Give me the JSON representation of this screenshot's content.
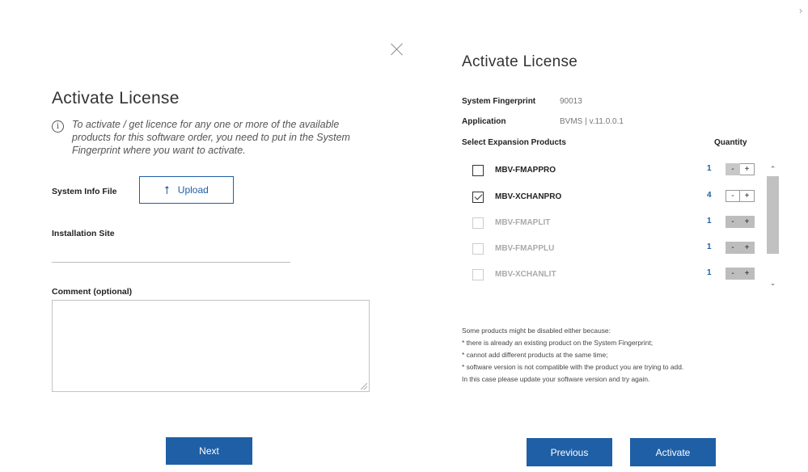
{
  "left": {
    "title": "Activate License",
    "info_text": "To activate / get licence for any one or more of the available products for this software order, you need to put in the System Fingerprint where you want to activate.",
    "system_info_label": "System Info File",
    "upload_label": "Upload",
    "installation_site_label": "Installation Site",
    "installation_site_value": "",
    "comment_label": "Comment (optional)",
    "comment_value": "",
    "next_label": "Next"
  },
  "right": {
    "title": "Activate License",
    "fingerprint_key": "System Fingerprint",
    "fingerprint_value": "90013",
    "application_key": "Application",
    "application_value": "BVMS | v.11.0.0.1",
    "select_label": "Select Expansion Products",
    "quantity_label": "Quantity",
    "products": [
      {
        "name": "MBV-FMAPPRO",
        "qty": "1",
        "checked": false,
        "disabled": false
      },
      {
        "name": "MBV-XCHANPRO",
        "qty": "4",
        "checked": true,
        "disabled": false
      },
      {
        "name": "MBV-FMAPLIT",
        "qty": "1",
        "checked": false,
        "disabled": true
      },
      {
        "name": "MBV-FMAPPLU",
        "qty": "1",
        "checked": false,
        "disabled": true
      },
      {
        "name": "MBV-XCHANLIT",
        "qty": "1",
        "checked": false,
        "disabled": true
      }
    ],
    "stepper_minus": "-",
    "stepper_plus": "+",
    "notes": [
      "Some products might be disabled either because:",
      "* there is already an existing product on the System Fingerprint;",
      "* cannot add different products at the same time;",
      "* software version is not compatible with the product you are trying to add.",
      "In this case please update your software version and try again."
    ],
    "previous_label": "Previous",
    "activate_label": "Activate"
  },
  "icons": {
    "info": "i",
    "upload_arrow": "⭡",
    "scroll_up": "⌃",
    "scroll_down": "⌄",
    "edge_chevron": "›"
  },
  "colors": {
    "primary": "#1f5fa5",
    "disabled_text": "#aaaaaa"
  }
}
